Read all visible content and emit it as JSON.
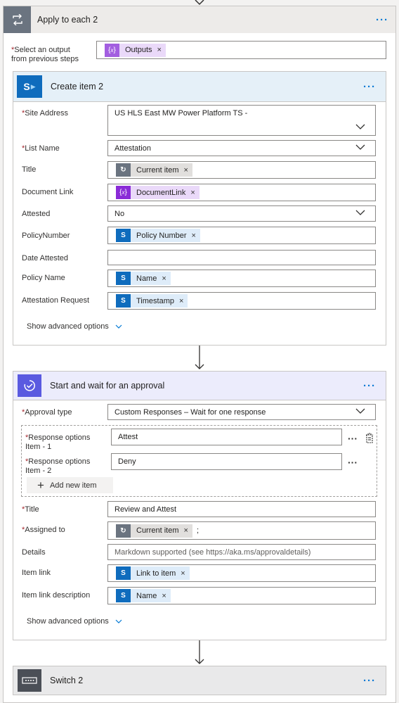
{
  "apply_each": {
    "title": "Apply to each 2",
    "select_label_1": "Select an output",
    "select_label_2": "from previous steps",
    "output_token": "Outputs"
  },
  "create_item": {
    "title": "Create item 2",
    "fields": {
      "site_address": {
        "label": "Site Address",
        "value": "US HLS East MW Power Platform TS -"
      },
      "list_name": {
        "label": "List Name",
        "value": "Attestation"
      },
      "title": {
        "label": "Title",
        "token": "Current item"
      },
      "document_link": {
        "label": "Document Link",
        "token": "DocumentLink"
      },
      "attested": {
        "label": "Attested",
        "value": "No"
      },
      "policy_number": {
        "label": "PolicyNumber",
        "token": "Policy Number"
      },
      "date_attested": {
        "label": "Date Attested",
        "value": ""
      },
      "policy_name": {
        "label": "Policy Name",
        "token": "Name"
      },
      "attestation_request": {
        "label": "Attestation Request",
        "token": "Timestamp"
      }
    },
    "show_advanced": "Show advanced options"
  },
  "approval": {
    "title": "Start and wait for an approval",
    "approval_type": {
      "label": "Approval type",
      "value": "Custom Responses – Wait for one response"
    },
    "response1": {
      "label_1": "Response options",
      "label_2": "Item - 1",
      "value": "Attest"
    },
    "response2": {
      "label_1": "Response options",
      "label_2": "Item - 2",
      "value": "Deny"
    },
    "add_item": "Add new item",
    "title_field": {
      "label": "Title",
      "value": "Review and Attest"
    },
    "assigned_to": {
      "label": "Assigned to",
      "token": "Current item",
      "suffix": ";"
    },
    "details": {
      "label": "Details",
      "placeholder": "Markdown supported (see https://aka.ms/approvaldetails)"
    },
    "item_link": {
      "label": "Item link",
      "token": "Link to item"
    },
    "item_link_desc": {
      "label": "Item link description",
      "token": "Name"
    },
    "show_advanced": "Show advanced options"
  },
  "switch": {
    "title": "Switch 2"
  },
  "glyphs": {
    "more": "···",
    "close": "×",
    "required": "*",
    "sharepoint": "S",
    "expression": "{x}",
    "plus": "+"
  },
  "colors": {
    "accent": "#0078d4",
    "sharepoint": "#0f6cbd",
    "approval": "#5a5ae0",
    "loop": "#6b7480",
    "switch": "#4b4f57"
  }
}
